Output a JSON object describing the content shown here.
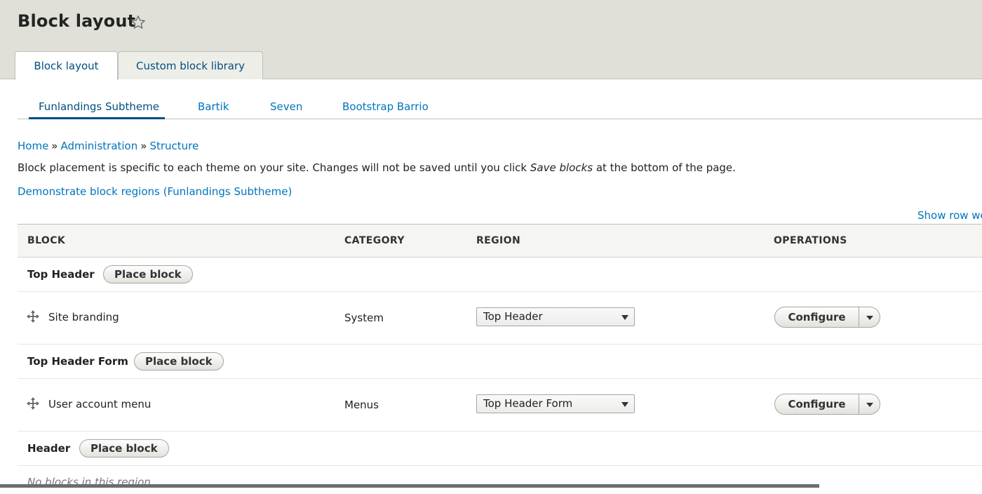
{
  "header": {
    "title": "Block layout",
    "star_icon": "star-outline-icon",
    "tabs": [
      {
        "label": "Block layout",
        "active": true
      },
      {
        "label": "Custom block library",
        "active": false
      }
    ]
  },
  "theme_tabs": [
    {
      "label": "Funlandings Subtheme",
      "active": true
    },
    {
      "label": "Bartik",
      "active": false
    },
    {
      "label": "Seven",
      "active": false
    },
    {
      "label": "Bootstrap Barrio",
      "active": false
    }
  ],
  "breadcrumb": {
    "items": [
      "Home",
      "Administration",
      "Structure"
    ],
    "separator": "»"
  },
  "description": {
    "before": "Block placement is specific to each theme on your site. Changes will not be saved until you click ",
    "emphasis": "Save blocks",
    "after": " at the bottom of the page."
  },
  "demo_link": "Demonstrate block regions (Funlandings Subtheme)",
  "row_weights_link": "Show row we",
  "table": {
    "headers": {
      "block": "BLOCK",
      "category": "CATEGORY",
      "region": "REGION",
      "operations": "OPERATIONS"
    },
    "place_block_label": "Place block",
    "configure_label": "Configure",
    "regions": [
      {
        "title": "Top Header",
        "blocks": [
          {
            "name": "Site branding",
            "category": "System",
            "region": "Top Header"
          }
        ]
      },
      {
        "title": "Top Header Form",
        "blocks": [
          {
            "name": "User account menu",
            "category": "Menus",
            "region": "Top Header Form"
          }
        ]
      },
      {
        "title": "Header",
        "empty_text": "No blocks in this region"
      }
    ]
  },
  "colors": {
    "link": "#0074bd",
    "header_bg": "#e0e0d8",
    "active_tab": "#004f80"
  }
}
